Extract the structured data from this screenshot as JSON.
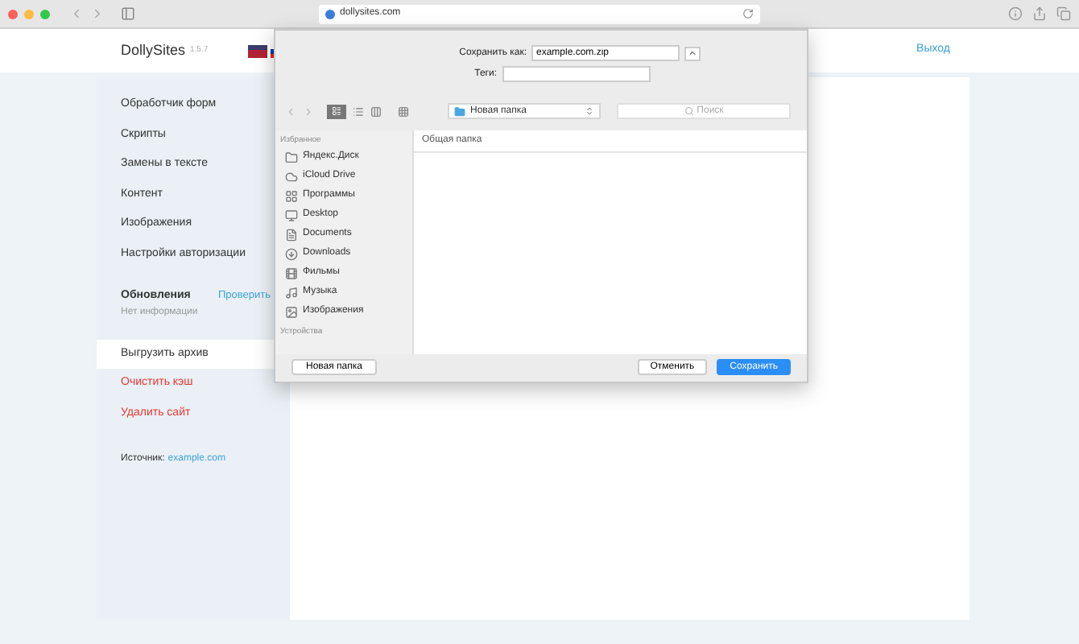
{
  "browser": {
    "address": "dollysites.com"
  },
  "header": {
    "logo": "DollySites",
    "version": "1.5.7",
    "logout": "Выход"
  },
  "sidebar": {
    "items": [
      {
        "label": "Обработчик форм",
        "kind": "normal",
        "selected": false
      },
      {
        "label": "Скрипты",
        "kind": "normal",
        "selected": false
      },
      {
        "label": "Замены в тексте",
        "kind": "normal",
        "selected": false
      },
      {
        "label": "Контент",
        "kind": "normal",
        "selected": false
      },
      {
        "label": "Изображения",
        "kind": "normal",
        "selected": false
      },
      {
        "label": "Настройки авторизации",
        "kind": "normal",
        "selected": false
      }
    ],
    "updates": {
      "title": "Обновления",
      "action": "Проверить",
      "status": "Нет информации"
    },
    "actions": [
      {
        "label": "Выгрузить архив",
        "kind": "normal",
        "selected": true
      },
      {
        "label": "Очистить кэш",
        "kind": "danger",
        "selected": false
      },
      {
        "label": "Удалить сайт",
        "kind": "danger",
        "selected": false
      }
    ],
    "source": {
      "label": "Источник:",
      "link": "example.com"
    }
  },
  "dialog": {
    "save_as_label": "Сохранить как:",
    "save_as_value": "example.com.zip",
    "tags_label": "Теги:",
    "location": "Новая папка",
    "search_placeholder": "Поиск",
    "favorites_heading": "Избранное",
    "favorites": [
      "Яндекс.Диск",
      "iCloud Drive",
      "Программы",
      "Desktop",
      "Documents",
      "Downloads",
      "Фильмы",
      "Музыка",
      "Изображения"
    ],
    "devices_heading": "Устройства",
    "column_header": "Общая папка",
    "new_folder_button": "Новая папка",
    "cancel_button": "Отменить",
    "save_button": "Сохранить"
  }
}
